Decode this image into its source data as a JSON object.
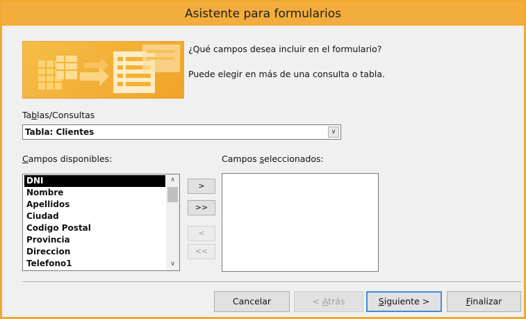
{
  "window": {
    "title": "Asistente para formularios"
  },
  "header": {
    "question": "¿Qué campos desea incluir en el formulario?",
    "hint": "Puede elegir en más de una consulta o tabla."
  },
  "tables": {
    "label_pre": "Ta",
    "label_u": "b",
    "label_post": "las/Consultas",
    "selected": "Tabla: Clientes"
  },
  "available": {
    "label_u": "C",
    "label_post": "ampos disponibles:",
    "items": [
      "DNI",
      "Nombre",
      "Apellidos",
      "Ciudad",
      "Codigo Postal",
      "Provincia",
      "Direccion",
      "Telefono1"
    ],
    "selected_index": 0
  },
  "selected_fields": {
    "label_pre": "Campos ",
    "label_u": "s",
    "label_post": "eleccionados:",
    "items": []
  },
  "move_buttons": {
    "add_one": ">",
    "add_all": ">>",
    "remove_one": "<",
    "remove_all": "<<"
  },
  "footer": {
    "cancel": "Cancelar",
    "back_pre": "< ",
    "back_u": "A",
    "back_post": "trás",
    "next_pre": "S",
    "next_u": "i",
    "next_post": "guiente >",
    "finish_u": "F",
    "finish_post": "inalizar"
  },
  "colors": {
    "titlebar": "#f3ad3c",
    "banner": "#f0a328",
    "default_button_border": "#3c8ddb"
  }
}
